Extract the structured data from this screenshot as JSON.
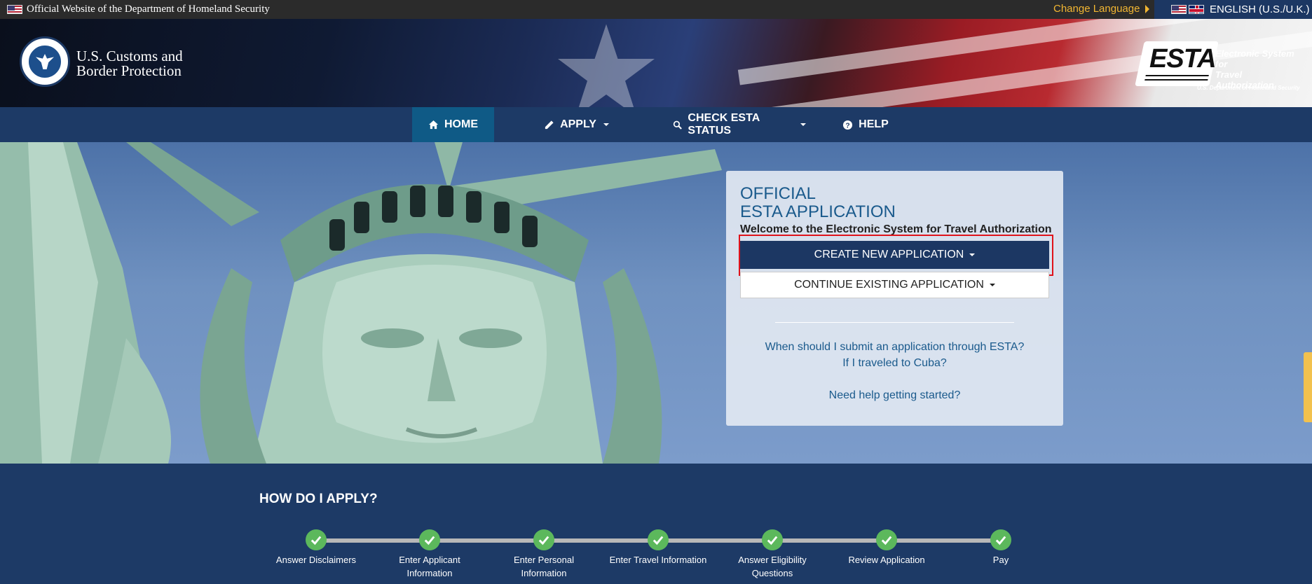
{
  "topbar": {
    "official_text": "Official Website of the Department of Homeland Security",
    "change_language": "Change Language",
    "current_language": "ENGLISH (U.S./U.K.)"
  },
  "header": {
    "agency_line1": "U.S. Customs and",
    "agency_line2": "Border Protection",
    "esta_logo_text": "ESTA",
    "esta_tagline_line1": "Electronic System for",
    "esta_tagline_line2": "Travel Authorization",
    "esta_dept": "U.S. Department of Homeland Security"
  },
  "nav": {
    "items": [
      {
        "label": "HOME",
        "icon": "home-icon",
        "active": true
      },
      {
        "label": "APPLY",
        "icon": "pencil-icon",
        "dropdown": true
      },
      {
        "label": "CHECK ESTA STATUS",
        "icon": "search-icon",
        "dropdown": true
      },
      {
        "label": "HELP",
        "icon": "help-icon"
      }
    ]
  },
  "panel": {
    "title_line1": "OFFICIAL",
    "title_line2": "ESTA APPLICATION",
    "welcome": "Welcome to the Electronic System for Travel Authorization",
    "create_button": "CREATE NEW APPLICATION",
    "continue_button": "CONTINUE EXISTING APPLICATION",
    "link_when": "When should I submit an application through ESTA?",
    "link_cuba": "If I traveled to Cuba?",
    "link_help": "Need help getting started?"
  },
  "howto": {
    "title": "HOW DO I APPLY?",
    "steps": [
      {
        "line1": "Answer Disclaimers",
        "line2": ""
      },
      {
        "line1": "Enter Applicant",
        "line2": "Information"
      },
      {
        "line1": "Enter Personal",
        "line2": "Information"
      },
      {
        "line1": "Enter Travel Information",
        "line2": ""
      },
      {
        "line1": "Answer Eligibility",
        "line2": "Questions"
      },
      {
        "line1": "Review Application",
        "line2": ""
      },
      {
        "line1": "Pay",
        "line2": ""
      }
    ]
  },
  "colors": {
    "nav_bg": "#1d3a66",
    "nav_active": "#0f5a86",
    "accent_gold": "#f2b632",
    "panel_title": "#1a5a8c",
    "highlight_red": "#e0131b",
    "step_green": "#5cb85c"
  }
}
